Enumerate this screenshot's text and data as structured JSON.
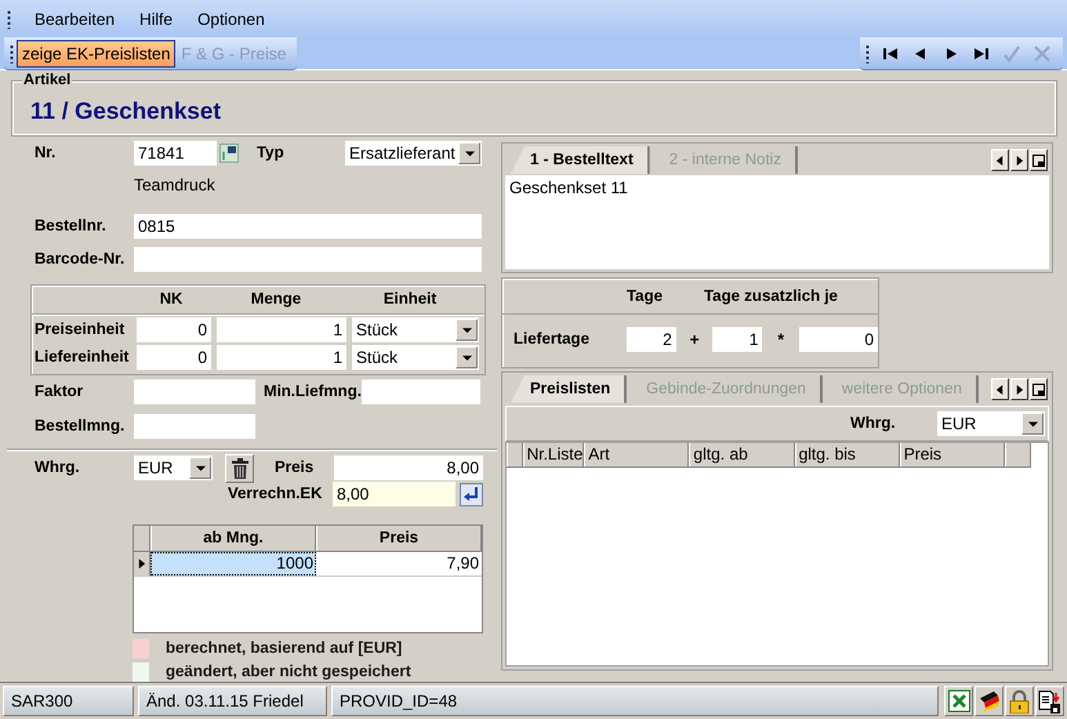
{
  "menu": [
    {
      "label": "Bearbeiten"
    },
    {
      "label": "Hilfe"
    },
    {
      "label": "Optionen"
    }
  ],
  "toolbar": [
    {
      "label": "zeige EK-Preislisten",
      "selected": true,
      "disabled": false
    },
    {
      "label": "F & G - Preise",
      "selected": false,
      "disabled": true
    }
  ],
  "navigator": [
    {
      "kind": "first",
      "disabled": false
    },
    {
      "kind": "prev",
      "disabled": false
    },
    {
      "kind": "next",
      "disabled": false
    },
    {
      "kind": "last",
      "disabled": false
    },
    {
      "kind": "confirm",
      "disabled": true
    },
    {
      "kind": "cancel",
      "disabled": true
    }
  ],
  "artikel": {
    "legend": "Artikel",
    "title": "11 / Geschenkset"
  },
  "supplier": {
    "nr_label": "Nr.",
    "nr": "71841",
    "typ_label": "Typ",
    "typ": "Ersatzlieferant",
    "name": "Teamdruck",
    "bestellnr_label": "Bestellnr.",
    "bestellnr": "0815",
    "barcode_label": "Barcode-Nr."
  },
  "units": {
    "columns": [
      "NK",
      "Menge",
      "Einheit"
    ],
    "rows": [
      {
        "label": "Preiseinheit",
        "nk": "0",
        "menge": "1",
        "einheit": "Stück"
      },
      {
        "label": "Liefereinheit",
        "nk": "0",
        "menge": "1",
        "einheit": "Stück"
      }
    ]
  },
  "quantities": {
    "faktor_label": "Faktor",
    "min_label": "Min.Liefmng.",
    "bestellmng_label": "Bestellmng."
  },
  "price": {
    "whrg_label": "Whrg.",
    "whrg": "EUR",
    "preis_label": "Preis",
    "preis": "8,00",
    "verrechn_label": "Verrechn.EK",
    "verrechn": "8,00"
  },
  "scale_grid": {
    "columns": [
      "ab Mng.",
      "Preis"
    ],
    "rows": [
      {
        "cells": [
          "1000",
          "7,90"
        ],
        "selected": true
      }
    ]
  },
  "legend": [
    {
      "text": "berechnet, basierend auf [EUR]",
      "color": "#f8d0d0"
    },
    {
      "text": "geändert, aber nicht gespeichert",
      "color": "#eef8ee"
    }
  ],
  "text_tabs": [
    {
      "label": "1 - Bestelltext",
      "selected": true
    },
    {
      "label": "2 - interne Notiz",
      "selected": false
    }
  ],
  "bestelltext": "Geschenkset 11",
  "liefertage": {
    "columns": [
      "Tage",
      "Tage zusatzlich je"
    ],
    "label": "Liefertage",
    "values": [
      "2",
      "1",
      "0"
    ],
    "operators": [
      "+",
      "*"
    ]
  },
  "list_tabs": [
    {
      "label": "Preislisten",
      "selected": true
    },
    {
      "label": "Gebinde-Zuordnungen",
      "selected": false
    },
    {
      "label": "weitere Optionen",
      "selected": false
    }
  ],
  "pricelists": {
    "whrg_label": "Whrg.",
    "whrg": "EUR",
    "columns": [
      "Nr.Liste",
      "Art",
      "gltg. ab",
      "gltg. bis",
      "Preis"
    ]
  },
  "status_bar": {
    "panels": [
      "SAR300",
      "Änd. 03.11.15 Friedel",
      "PROVID_ID=48"
    ]
  }
}
